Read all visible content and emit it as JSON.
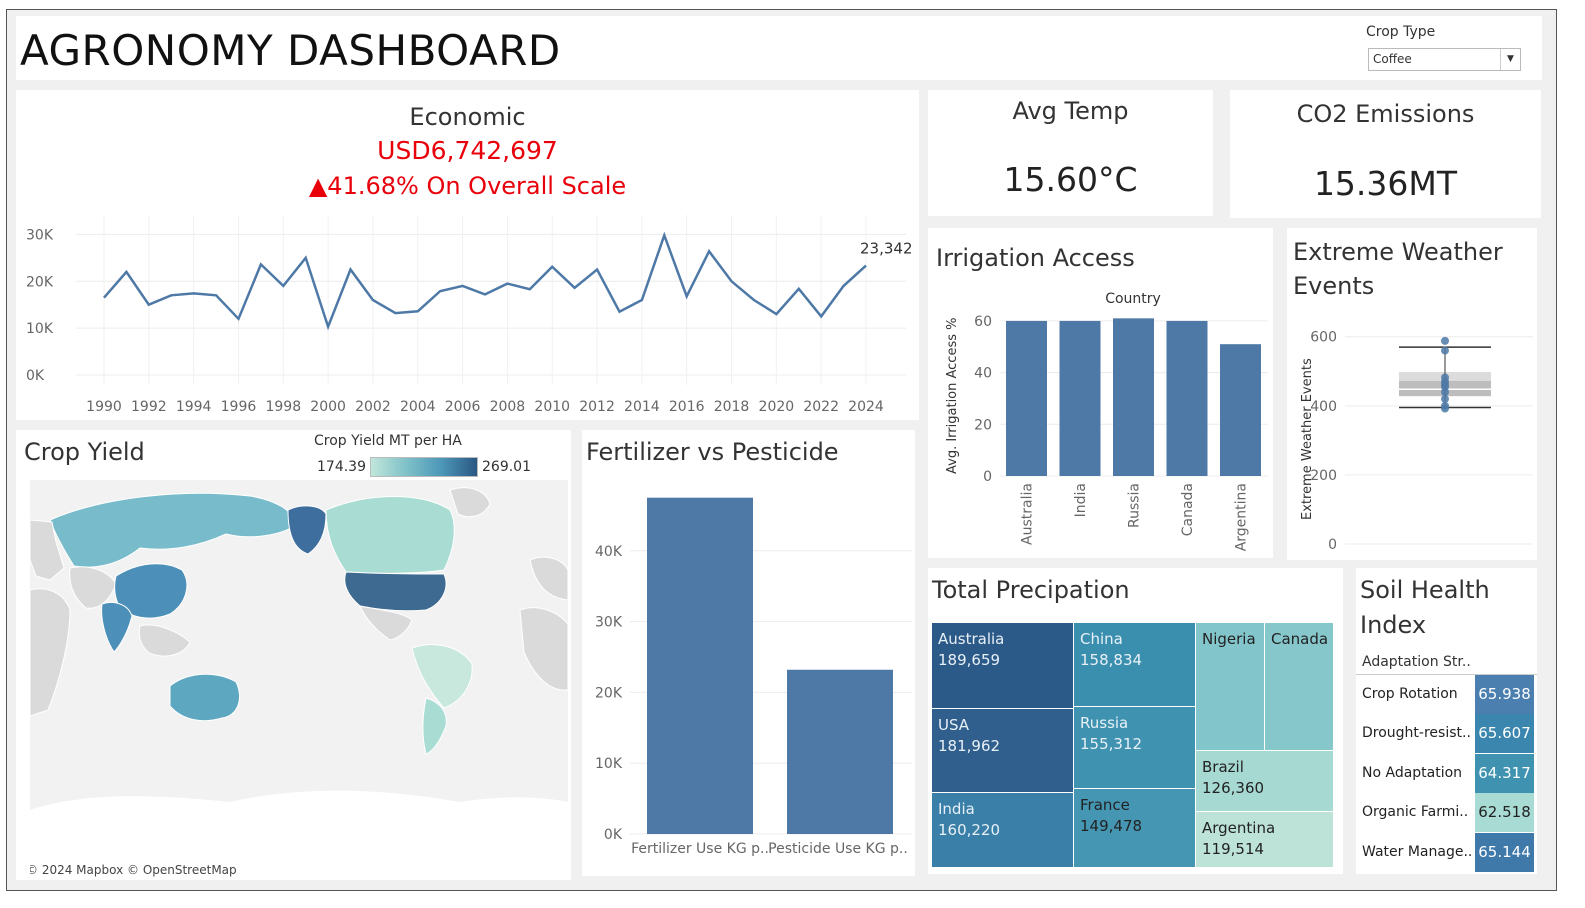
{
  "dashboard": {
    "title": "AGRONOMY DASHBOARD"
  },
  "filter": {
    "label": "Crop Type",
    "selected": "Coffee"
  },
  "economic": {
    "title": "Economic",
    "value": "USD6,742,697",
    "change": "▲41.68% On Overall Scale",
    "last_label": "23,342"
  },
  "avg_temp": {
    "title": "Avg Temp",
    "value": "15.60°C"
  },
  "co2": {
    "title": "CO2 Emissions",
    "value": "15.36MT"
  },
  "irrigation": {
    "title": "Irrigation Access",
    "header": "Country",
    "ylabel": "Avg. Irrigation Access %"
  },
  "weather": {
    "title_line1": "Extreme Weather",
    "title_line2": "Events",
    "ylabel": "Extreme Weather Events"
  },
  "crop_yield": {
    "title": "Crop Yield",
    "legend_title": "Crop Yield MT per HA",
    "legend_min": "174.39",
    "legend_max": "269.01",
    "attribution": "© 2024 Mapbox © OpenStreetMap"
  },
  "fert": {
    "title": "Fertilizer vs Pesticide"
  },
  "precip": {
    "title": "Total Precipation"
  },
  "soil": {
    "title_line1": "Soil Health",
    "title_line2": "Index",
    "header": "Adaptation Str.."
  },
  "colors": {
    "line": "#4e79a7",
    "bar": "#4e79a7",
    "kpi_red": "#e8000b",
    "treemap_dark": "#2a5783",
    "treemap_light": "#c1e6db"
  },
  "chart_data": [
    {
      "type": "line",
      "x": [
        1990,
        1991,
        1992,
        1993,
        1994,
        1995,
        1996,
        1997,
        1998,
        1999,
        2000,
        2001,
        2002,
        2003,
        2004,
        2005,
        2006,
        2007,
        2008,
        2009,
        2010,
        2011,
        2012,
        2013,
        2014,
        2015,
        2016,
        2017,
        2018,
        2019,
        2020,
        2021,
        2022,
        2023,
        2024
      ],
      "values": [
        16500,
        22000,
        15000,
        17000,
        17400,
        17000,
        12000,
        23600,
        19000,
        25000,
        10300,
        22500,
        16000,
        13200,
        13600,
        17900,
        19000,
        17200,
        19500,
        18300,
        23100,
        18600,
        22500,
        13500,
        16000,
        29800,
        16800,
        26400,
        20000,
        16000,
        13000,
        18400,
        12500,
        19000,
        23342
      ],
      "xticks": [
        "1990",
        "1992",
        "1994",
        "1996",
        "1998",
        "2000",
        "2002",
        "2004",
        "2006",
        "2008",
        "2010",
        "2012",
        "2014",
        "2016",
        "2018",
        "2020",
        "2022",
        "2024"
      ],
      "yticks": [
        "0K",
        "10K",
        "20K",
        "30K"
      ],
      "ylim": [
        0,
        32000
      ]
    },
    {
      "type": "bar",
      "categories": [
        "Australia",
        "India",
        "Russia",
        "Canada",
        "Argentina"
      ],
      "values": [
        60,
        60,
        61,
        60,
        51
      ],
      "yticks": [
        "0",
        "20",
        "40",
        "60"
      ],
      "ylim": [
        0,
        65
      ]
    },
    {
      "type": "scatter",
      "points": [
        588,
        560,
        482,
        470,
        462,
        455,
        440,
        420,
        400,
        392
      ],
      "whisker_low": 395,
      "q1": 428,
      "median": 448,
      "q3": 472,
      "upper_q": 498,
      "whisker_high": 570,
      "yticks": [
        "0",
        "200",
        "400",
        "600"
      ],
      "ylim": [
        0,
        660
      ]
    },
    {
      "type": "bar",
      "categories": [
        "Fertilizer Use KG p..",
        "Pesticide Use KG p.."
      ],
      "values": [
        47500,
        23200
      ],
      "yticks": [
        "0K",
        "10K",
        "20K",
        "30K",
        "40K"
      ],
      "ylim": [
        0,
        50000
      ]
    },
    {
      "type": "heatmap",
      "title": "Total Precipation",
      "cells": [
        {
          "name": "Australia",
          "value": "189,659"
        },
        {
          "name": "USA",
          "value": "181,962"
        },
        {
          "name": "India",
          "value": "160,220"
        },
        {
          "name": "China",
          "value": "158,834"
        },
        {
          "name": "Russia",
          "value": "155,312"
        },
        {
          "name": "France",
          "value": "149,478"
        },
        {
          "name": "Nigeria",
          "value": ""
        },
        {
          "name": "Canada",
          "value": ""
        },
        {
          "name": "Brazil",
          "value": "126,360"
        },
        {
          "name": "Argentina",
          "value": "119,514"
        }
      ]
    },
    {
      "type": "table",
      "rows": [
        {
          "label": "Crop Rotation",
          "value": "65.938"
        },
        {
          "label": "Drought-resist..",
          "value": "65.607"
        },
        {
          "label": "No Adaptation",
          "value": "64.317"
        },
        {
          "label": "Organic Farmi..",
          "value": "62.518"
        },
        {
          "label": "Water Manage..",
          "value": "65.144"
        }
      ]
    }
  ]
}
